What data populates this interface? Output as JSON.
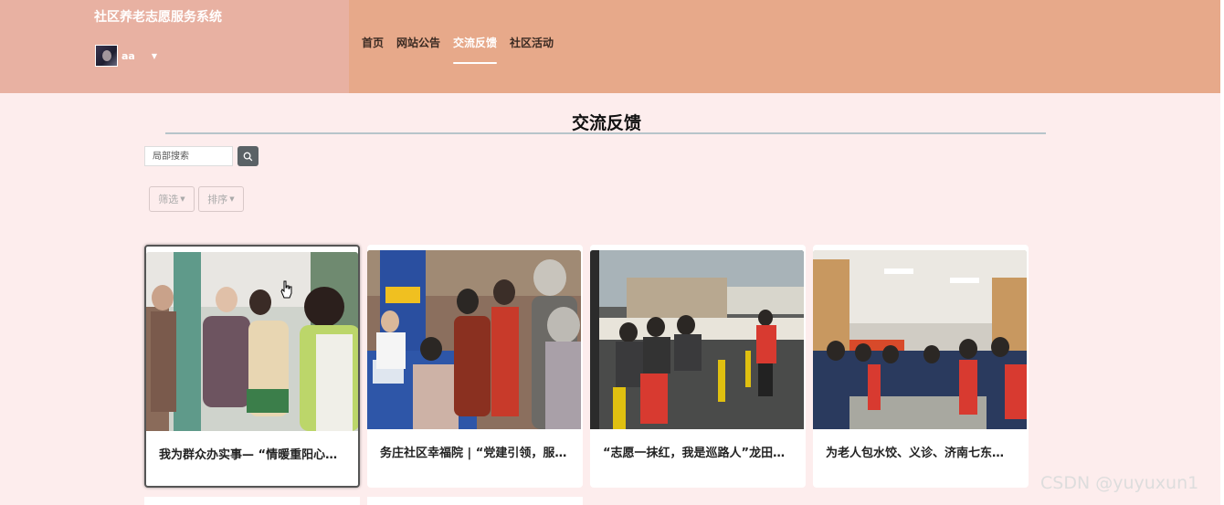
{
  "header": {
    "site_title": "社区养老志愿服务系统",
    "username": "aa",
    "nav": [
      {
        "label": "首页",
        "active": false
      },
      {
        "label": "网站公告",
        "active": false
      },
      {
        "label": "交流反馈",
        "active": true
      },
      {
        "label": "社区活动",
        "active": false
      }
    ]
  },
  "main": {
    "title": "交流反馈",
    "search_placeholder": "局部搜索",
    "filter_label": "筛选",
    "sort_label": "排序",
    "cards": [
      {
        "title": "我为群众办实事— “情暖重阳心…"
      },
      {
        "title": "务庄社区幸福院 | “党建引领，服…"
      },
      {
        "title": "“志愿一抹红，我是巡路人”龙田…"
      },
      {
        "title": "为老人包水饺、义诊、济南七东…"
      }
    ]
  },
  "watermark": "CSDN @yuyuxun1",
  "colors": {
    "header_bg": "#e7a98a",
    "header_left_bg": "#e8b1a2",
    "page_bg": "#fdeded"
  }
}
